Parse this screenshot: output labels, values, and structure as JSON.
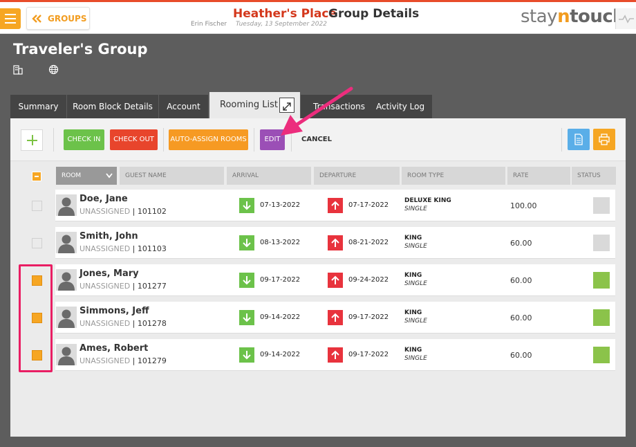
{
  "header": {
    "back_label": "GROUPS",
    "hotel_name": "Heather's Place",
    "page_title": "Group Details",
    "user_name": "Erin Fischer",
    "business_date": "Tuesday, 13 September 2022",
    "logo": {
      "part1": "stay",
      "part2": "n",
      "part3": "touch"
    }
  },
  "group": {
    "title": "Traveler's Group"
  },
  "tabs": [
    "Summary",
    "Room Block Details",
    "Account",
    "Rooming List",
    "Transactions",
    "Activity Log"
  ],
  "active_tab": "Rooming List",
  "toolbar": {
    "check_in": "CHECK IN",
    "check_out": "CHECK OUT",
    "auto_assign": "AUTO-ASSIGN ROOMS",
    "edit": "EDIT",
    "cancel": "CANCEL"
  },
  "table": {
    "columns": [
      "ROOM",
      "GUEST NAME",
      "ARRIVAL",
      "DEPARTURE",
      "ROOM TYPE",
      "RATE",
      "STATUS"
    ],
    "rows": [
      {
        "name": "Doe, Jane",
        "room": "UNASSIGNED",
        "conf": "101102",
        "arrival": "07-13-2022",
        "departure": "07-17-2022",
        "room_type": "DELUXE KING",
        "occupancy": "SINGLE",
        "rate": "100.00",
        "checked": false,
        "status_color": "#d9d9d9"
      },
      {
        "name": "Smith, John",
        "room": "UNASSIGNED",
        "conf": "101103",
        "arrival": "08-13-2022",
        "departure": "08-21-2022",
        "room_type": "KING",
        "occupancy": "SINGLE",
        "rate": "60.00",
        "checked": false,
        "status_color": "#d9d9d9"
      },
      {
        "name": "Jones, Mary",
        "room": "UNASSIGNED",
        "conf": "101277",
        "arrival": "09-17-2022",
        "departure": "09-24-2022",
        "room_type": "KING",
        "occupancy": "SINGLE",
        "rate": "60.00",
        "checked": true,
        "status_color": "#8bc34a"
      },
      {
        "name": "Simmons, Jeff",
        "room": "UNASSIGNED",
        "conf": "101278",
        "arrival": "09-14-2022",
        "departure": "09-17-2022",
        "room_type": "KING",
        "occupancy": "SINGLE",
        "rate": "60.00",
        "checked": true,
        "status_color": "#8bc34a"
      },
      {
        "name": "Ames, Robert",
        "room": "UNASSIGNED",
        "conf": "101279",
        "arrival": "09-14-2022",
        "departure": "09-17-2022",
        "room_type": "KING",
        "occupancy": "SINGLE",
        "rate": "60.00",
        "checked": true,
        "status_color": "#8bc34a"
      }
    ]
  },
  "colors": {
    "accent_orange": "#f6a623",
    "hotel_red": "#d4381c",
    "check_in_green": "#6cc24a",
    "check_out_red": "#e8452c",
    "edit_purple": "#9b4fb6",
    "annotation_pink": "#e91e63"
  },
  "icons": {
    "menu": "hamburger-icon",
    "back": "double-chevron-left-icon",
    "building": "building-icon",
    "globe": "globe-icon",
    "expand": "expand-icon",
    "add": "plus-icon",
    "document": "document-icon",
    "print": "printer-icon",
    "arrival": "arrow-down-icon",
    "departure": "arrow-up-icon",
    "avatar": "person-silhouette-icon",
    "pulse": "pulse-icon"
  }
}
